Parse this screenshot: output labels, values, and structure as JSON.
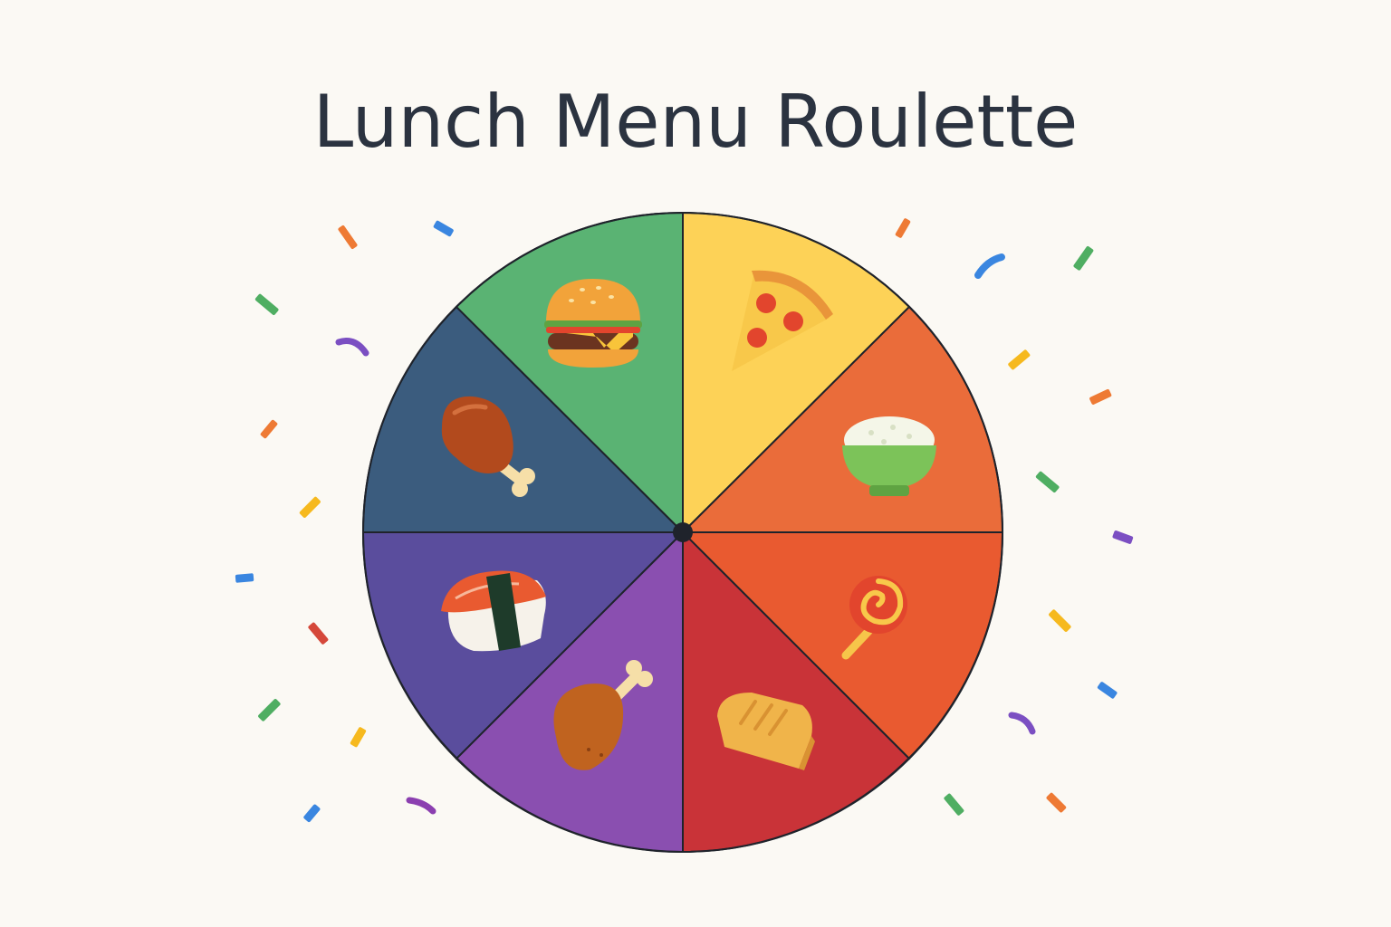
{
  "title": "Lunch Menu Roulette",
  "wheel": {
    "segments": [
      {
        "icon": "burger-icon",
        "color": "#fdd257"
      },
      {
        "icon": "pizza-icon",
        "color": "#ea6c3a"
      },
      {
        "icon": "rice-bowl-icon",
        "color": "#e95a30"
      },
      {
        "icon": "lollipop-icon",
        "color": "#c93338"
      },
      {
        "icon": "bread-icon",
        "color": "#8a4fb0"
      },
      {
        "icon": "chicken-leg-icon",
        "color": "#5a4d9d"
      },
      {
        "icon": "sushi-icon",
        "color": "#3b5c7e"
      },
      {
        "icon": "chicken-drumstick-icon",
        "color": "#5ab373"
      }
    ],
    "hub_color": "#1f232b",
    "outline_color": "#1f232b"
  },
  "confetti_colors": [
    "#ee7a34",
    "#3a86e0",
    "#4fae62",
    "#7b4fc2",
    "#f6b91e",
    "#d5483a"
  ]
}
